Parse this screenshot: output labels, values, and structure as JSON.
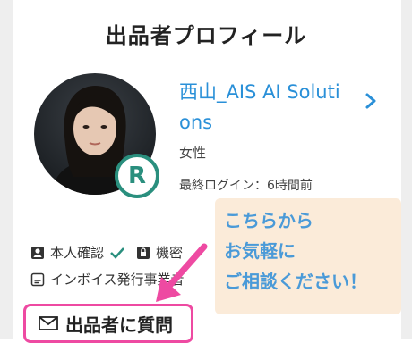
{
  "header": {
    "title": "出品者プロフィール"
  },
  "profile": {
    "name": "西山_AIS AI Solutions",
    "gender": "女性",
    "last_login": "最終ログイン：6時間前",
    "badge_letter": "R"
  },
  "verification": {
    "identity_label": "本人確認",
    "second_label": "機密",
    "invoice_label": "インボイス発行事業者"
  },
  "callout": {
    "line1": "こちらから",
    "line2": "お気軽に",
    "line3": "ご相談ください！"
  },
  "actions": {
    "ask_label": "出品者に質問"
  },
  "colors": {
    "accent_blue": "#2a90d8",
    "badge_green": "#2a8f7e",
    "highlight_pink": "#ee4aa2",
    "callout_bg": "#fbe9d6"
  },
  "icons": [
    "person-card-icon",
    "check-icon",
    "lock-icon",
    "document-icon",
    "envelope-icon",
    "chevron-right-icon"
  ]
}
